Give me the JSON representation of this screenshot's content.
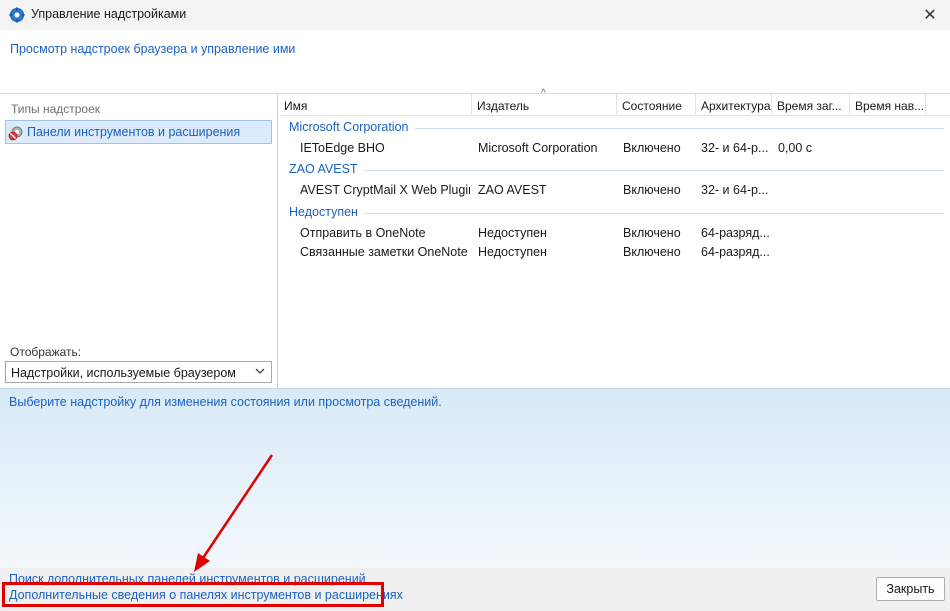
{
  "window": {
    "title": "Управление надстройками",
    "close_glyph": "✕",
    "app_icon": "ie-settings-icon"
  },
  "header": {
    "subtitle": "Просмотр надстроек браузера и управление ими"
  },
  "left_panel": {
    "types_label": "Типы надстроек",
    "selected_type": "Панели инструментов и расширения",
    "show_label": "Отображать:",
    "show_value": "Надстройки, используемые браузером"
  },
  "table": {
    "columns": [
      "Имя",
      "Издатель",
      "Состояние",
      "Архитектура",
      "Время заг...",
      "Время нав..."
    ],
    "sort_glyph": "^",
    "groups": [
      {
        "name": "Microsoft Corporation",
        "rows": [
          {
            "name": "IEToEdge BHO",
            "publisher": "Microsoft Corporation",
            "state": "Включено",
            "arch": "32- и 64-р...",
            "load": "0,00 с",
            "nav": ""
          }
        ]
      },
      {
        "name": "ZAO AVEST",
        "rows": [
          {
            "name": "AVEST CryptMail X Web Plugin",
            "publisher": "ZAO AVEST",
            "state": "Включено",
            "arch": "32- и 64-р...",
            "load": "",
            "nav": ""
          }
        ]
      },
      {
        "name": "Недоступен",
        "rows": [
          {
            "name": "Отправить в OneNote",
            "publisher": "Недоступен",
            "state": "Включено",
            "arch": "64-разряд...",
            "load": "",
            "nav": ""
          },
          {
            "name": "Связанные заметки OneNote",
            "publisher": "Недоступен",
            "state": "Включено",
            "arch": "64-разряд...",
            "load": "",
            "nav": ""
          }
        ]
      }
    ]
  },
  "details": {
    "hint": "Выберите надстройку для изменения состояния или просмотра сведений."
  },
  "footer": {
    "find_more": "Поиск дополнительных панелей инструментов и расширений",
    "learn_more": "Дополнительные сведения о панелях инструментов и расширениях",
    "close_button": "Закрыть"
  },
  "annotation": {
    "color": "#e00000"
  }
}
